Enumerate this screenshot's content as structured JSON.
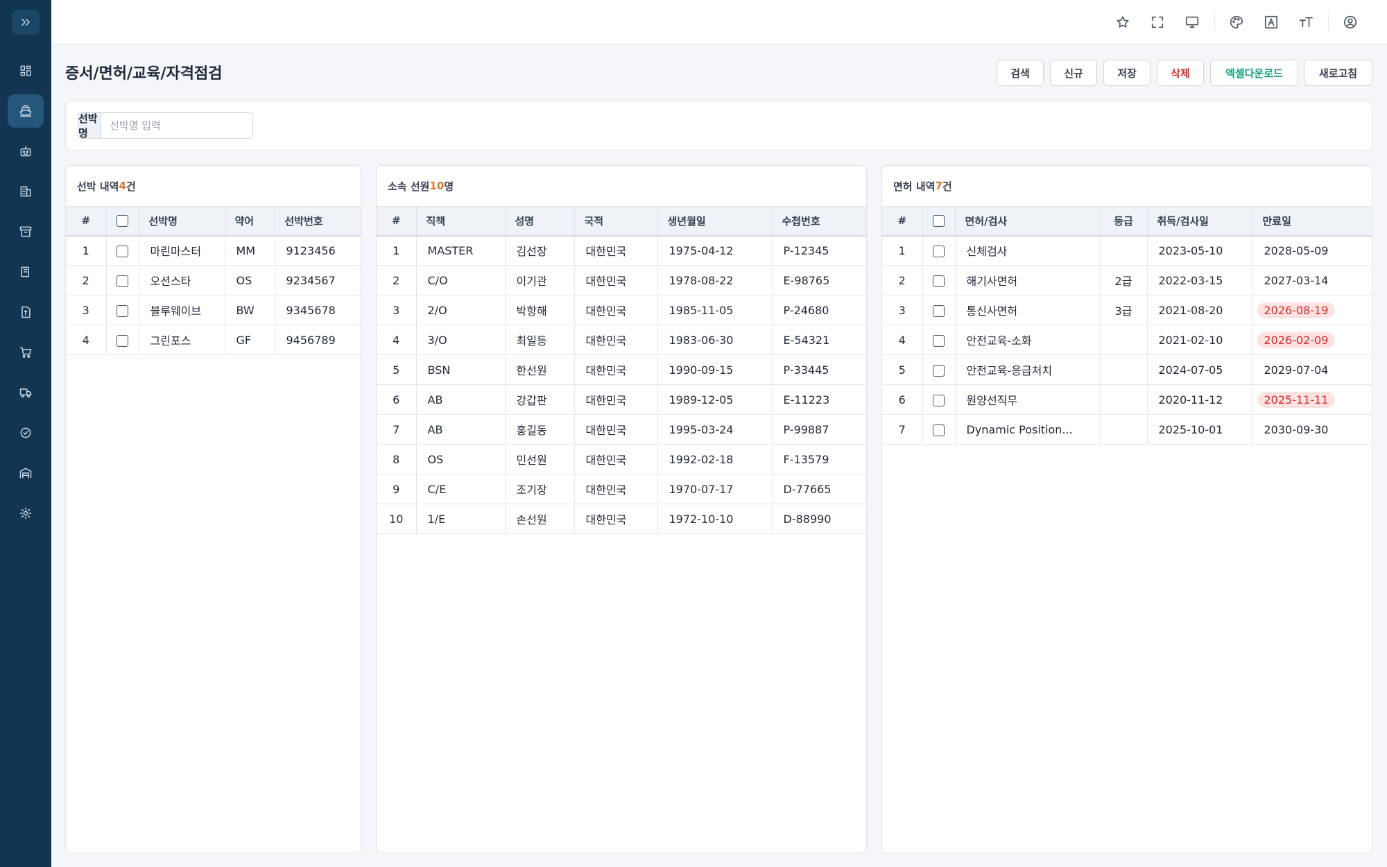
{
  "sidebar": {
    "items": [
      {
        "icon": "dashboard-icon",
        "active": false
      },
      {
        "icon": "ship-icon",
        "active": true
      },
      {
        "icon": "crew-icon",
        "active": false
      },
      {
        "icon": "building-icon",
        "active": false
      },
      {
        "icon": "archive-icon",
        "active": false
      },
      {
        "icon": "book-icon",
        "active": false
      },
      {
        "icon": "document-icon",
        "active": false
      },
      {
        "icon": "cart-icon",
        "active": false
      },
      {
        "icon": "truck-icon",
        "active": false
      },
      {
        "icon": "check-circle-icon",
        "active": false
      },
      {
        "icon": "warehouse-icon",
        "active": false
      },
      {
        "icon": "settings-icon",
        "active": false
      }
    ]
  },
  "header": {
    "icons": [
      "star-icon",
      "fullscreen-icon",
      "monitor-icon",
      "palette-icon",
      "font-icon",
      "text-size-icon",
      "user-icon"
    ]
  },
  "page": {
    "title": "증서/면허/교육/자격점검",
    "buttons": {
      "search": "검색",
      "new": "신규",
      "save": "저장",
      "delete": "삭제",
      "excel": "엑셀다운로드",
      "refresh": "새로고침"
    }
  },
  "search": {
    "label": "선박명",
    "placeholder": "선박명 입력",
    "value": ""
  },
  "vessels": {
    "title": "선박 내역 ",
    "count": "4",
    "unit": "건",
    "columns": [
      "#",
      "",
      "선박명",
      "약어",
      "선박번호"
    ],
    "rows": [
      [
        "1",
        "마린마스터",
        "MM",
        "9123456"
      ],
      [
        "2",
        "오션스타",
        "OS",
        "9234567"
      ],
      [
        "3",
        "블루웨이브",
        "BW",
        "9345678"
      ],
      [
        "4",
        "그린포스",
        "GF",
        "9456789"
      ]
    ]
  },
  "crew": {
    "title": "소속 선원 ",
    "count": "10",
    "unit": "명",
    "columns": [
      "#",
      "직책",
      "성명",
      "국적",
      "생년월일",
      "수첩번호"
    ],
    "rows": [
      [
        "1",
        "MASTER",
        "김선장",
        "대한민국",
        "1975-04-12",
        "P-12345"
      ],
      [
        "2",
        "C/O",
        "이기관",
        "대한민국",
        "1978-08-22",
        "E-98765"
      ],
      [
        "3",
        "2/O",
        "박항해",
        "대한민국",
        "1985-11-05",
        "P-24680"
      ],
      [
        "4",
        "3/O",
        "최일등",
        "대한민국",
        "1983-06-30",
        "E-54321"
      ],
      [
        "5",
        "BSN",
        "한선원",
        "대한민국",
        "1990-09-15",
        "P-33445"
      ],
      [
        "6",
        "AB",
        "강갑판",
        "대한민국",
        "1989-12-05",
        "E-11223"
      ],
      [
        "7",
        "AB",
        "홍길동",
        "대한민국",
        "1995-03-24",
        "P-99887"
      ],
      [
        "8",
        "OS",
        "민선원",
        "대한민국",
        "1992-02-18",
        "F-13579"
      ],
      [
        "9",
        "C/E",
        "조기장",
        "대한민국",
        "1970-07-17",
        "D-77665"
      ],
      [
        "10",
        "1/E",
        "손선원",
        "대한민국",
        "1972-10-10",
        "D-88990"
      ]
    ]
  },
  "licenses": {
    "title": "면허 내역 ",
    "count": "7",
    "unit": "건",
    "columns": [
      "#",
      "",
      "면허/검사",
      "등급",
      "취득/검사일",
      "만료일"
    ],
    "rows": [
      {
        "no": "1",
        "name": "신체검사",
        "grade": "",
        "acquired": "2023-05-10",
        "expiry": "2028-05-09",
        "expiring": false
      },
      {
        "no": "2",
        "name": "해기사면허",
        "grade": "2급",
        "acquired": "2022-03-15",
        "expiry": "2027-03-14",
        "expiring": false
      },
      {
        "no": "3",
        "name": "통신사면허",
        "grade": "3급",
        "acquired": "2021-08-20",
        "expiry": "2026-08-19",
        "expiring": true
      },
      {
        "no": "4",
        "name": "안전교육-소화",
        "grade": "",
        "acquired": "2021-02-10",
        "expiry": "2026-02-09",
        "expiring": true
      },
      {
        "no": "5",
        "name": "안전교육-응급처치",
        "grade": "",
        "acquired": "2024-07-05",
        "expiry": "2029-07-04",
        "expiring": false
      },
      {
        "no": "6",
        "name": "원양선직무",
        "grade": "",
        "acquired": "2020-11-12",
        "expiry": "2025-11-11",
        "expiring": true
      },
      {
        "no": "7",
        "name": "Dynamic Position...",
        "grade": "",
        "acquired": "2025-10-01",
        "expiry": "2030-09-30",
        "expiring": false
      }
    ]
  },
  "colors": {
    "sidebar": "#113552",
    "accent_count": "#e0722a",
    "danger": "#dc2626",
    "success": "#0f9f7a",
    "expiring_bg": "#fde2e2"
  }
}
